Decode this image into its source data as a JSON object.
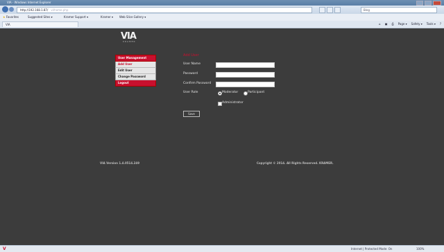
{
  "window": {
    "title": "VIA - Windows Internet Explorer"
  },
  "addressbar": {
    "url": "http://192.168.1.87/",
    "url_hint": "vi/home.php",
    "search_placeholder": "Bing"
  },
  "favorites": {
    "label": "Favorites",
    "items": [
      "Suggested Sites ▾",
      "Kramer Support ▾",
      "Kramer ▾",
      "Web Slice Gallery ▾"
    ]
  },
  "tab": {
    "label": "VIA"
  },
  "commandbar": {
    "page": "Page ▾",
    "safety": "Safety ▾",
    "tools": "Tools ▾"
  },
  "logo": {
    "text": "VIA",
    "subtitle": "KRAMER"
  },
  "menu": {
    "header": "User Management",
    "items": [
      "Add User",
      "Edit User",
      "Change Password"
    ],
    "logout": "Logout"
  },
  "form": {
    "title": "Add User",
    "username_label": "User Name",
    "password_label": "Password",
    "confirm_label": "Confirm Password",
    "role_label": "User Role",
    "role_moderator": "Moderator",
    "role_participant": "Participant",
    "admin_label": "Administrator",
    "save_label": "Save"
  },
  "footer": {
    "version": "VIA Version 1.4.0514.249",
    "copyright": "Copyright © 2014. All Rights Reserved. KRAMER."
  },
  "statusbar": {
    "zone": "Internet | Protected Mode: On",
    "zoom": "100%"
  },
  "colors": {
    "accent": "#c8102e",
    "background": "#3c3c3c"
  }
}
